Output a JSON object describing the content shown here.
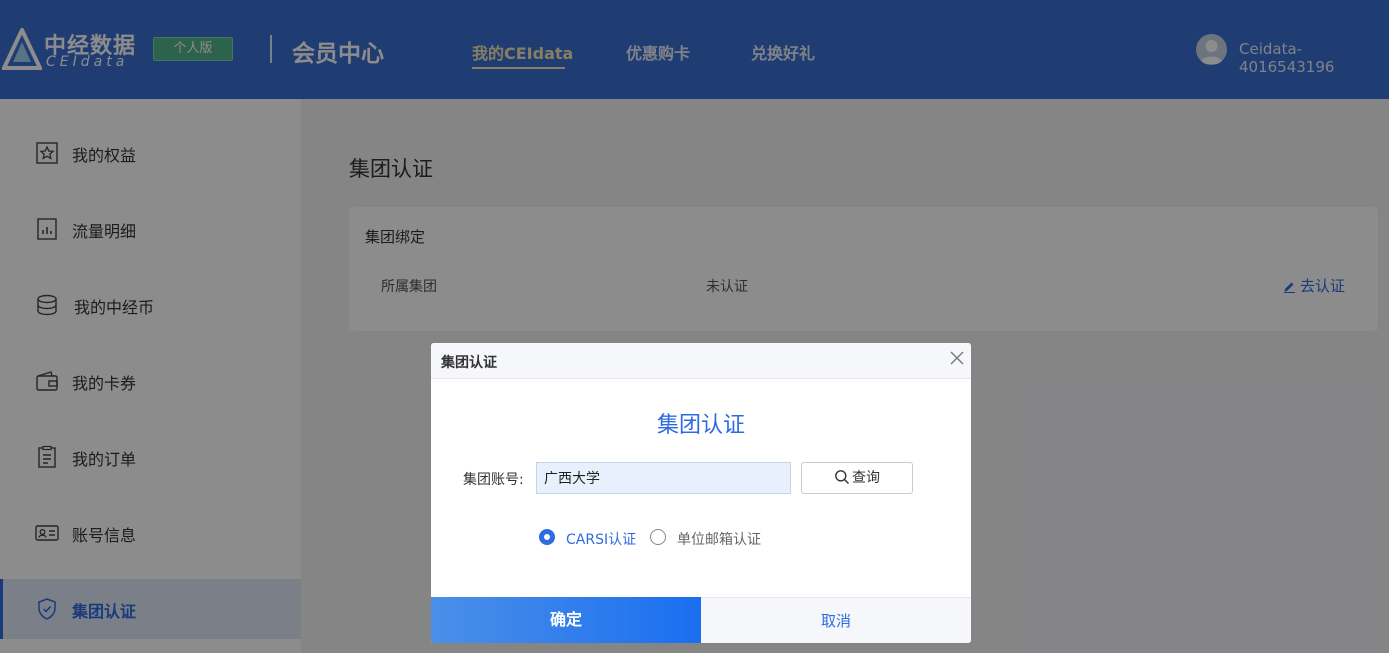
{
  "header": {
    "logo_cn": "中经数据",
    "logo_en": "CEIdata",
    "edition": "个人版",
    "title": "会员中心",
    "nav": [
      {
        "label": "我的CEIdata",
        "active": true
      },
      {
        "label": "优惠购卡",
        "active": false
      },
      {
        "label": "兑换好礼",
        "active": false
      }
    ],
    "user": "Ceidata-4016543196"
  },
  "sidebar": {
    "items": [
      {
        "label": "我的权益",
        "icon": "star-badge-icon"
      },
      {
        "label": "流量明细",
        "icon": "chart-doc-icon"
      },
      {
        "label": "我的中经币",
        "icon": "coin-stack-icon"
      },
      {
        "label": "我的卡券",
        "icon": "wallet-icon"
      },
      {
        "label": "我的订单",
        "icon": "order-list-icon"
      },
      {
        "label": "账号信息",
        "icon": "id-card-icon"
      },
      {
        "label": "集团认证",
        "icon": "shield-check-icon",
        "active": true
      }
    ]
  },
  "main": {
    "title": "集团认证",
    "card": {
      "title": "集团绑定",
      "label": "所属集团",
      "status": "未认证",
      "action": "去认证"
    }
  },
  "dialog": {
    "header_title": "集团认证",
    "title": "集团认证",
    "field_label": "集团账号:",
    "field_value": "广西大学",
    "query_label": "查询",
    "radios": [
      {
        "label": "CARSI认证",
        "checked": true
      },
      {
        "label": "单位邮箱认证",
        "checked": false
      }
    ],
    "ok_label": "确定",
    "cancel_label": "取消"
  },
  "colors": {
    "header_bg": "#3a6fd0",
    "accent": "#2f6be0",
    "edition_badge": "#52b58d",
    "nav_active": "#f3e6b5"
  }
}
